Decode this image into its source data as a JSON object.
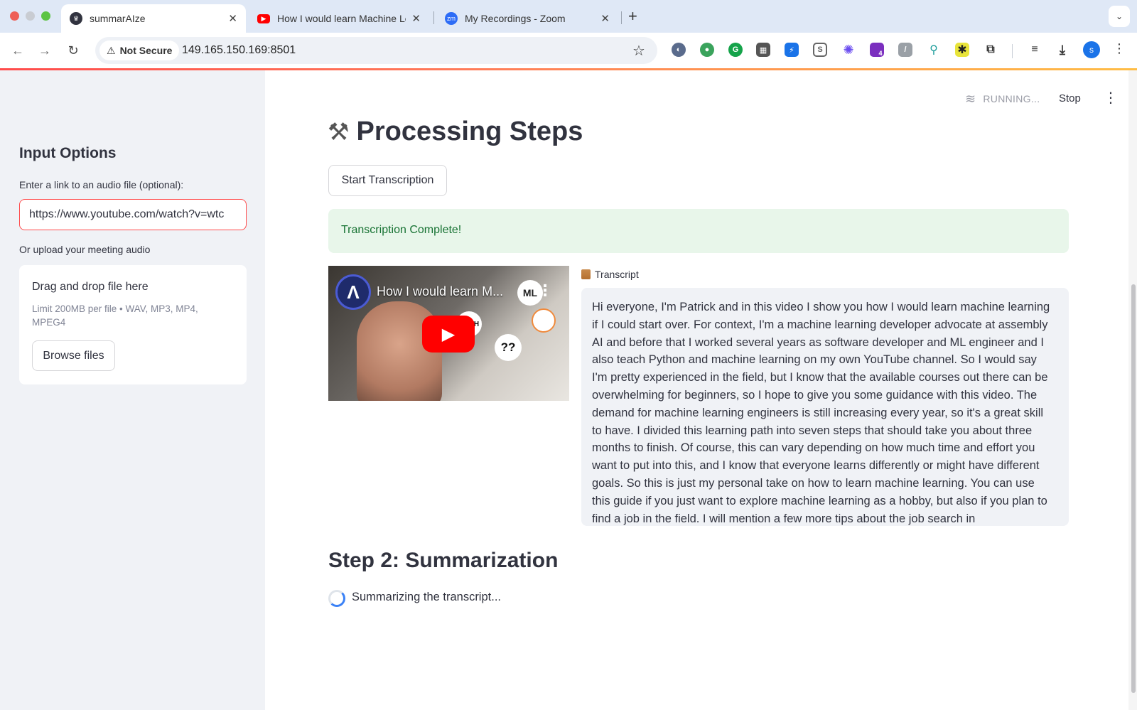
{
  "browser": {
    "tabs": [
      {
        "title": "summarAIze",
        "active": true
      },
      {
        "title": "How I would learn Machine Le",
        "active": false
      },
      {
        "title": "My Recordings - Zoom",
        "active": false
      }
    ],
    "new_tab": "+",
    "security_label": "Not Secure",
    "url": "149.165.150.169:8501",
    "profile_initial": "s",
    "extension_badge": "4"
  },
  "app": {
    "status": "RUNNING...",
    "stop_label": "Stop",
    "sidebar": {
      "title": "Input Options",
      "link_label": "Enter a link to an audio file (optional):",
      "link_value": "https://www.youtube.com/watch?v=wtc",
      "upload_label": "Or upload your meeting audio",
      "dropzone_title": "Drag and drop file here",
      "dropzone_limit": "Limit 200MB per file • WAV, MP3, MP4, MPEG4",
      "browse_label": "Browse files"
    },
    "main": {
      "title": "Processing Steps",
      "start_button": "Start Transcription",
      "success_message": "Transcription Complete!",
      "video": {
        "title": "How I would learn M...",
        "channel_initial": "Λ",
        "ml_badge": "ML",
        "qq_badge": "??",
        "math_badge": "MATH"
      },
      "transcript_label": "Transcript",
      "transcript_text": "Hi everyone, I'm Patrick and in this video I show you how I would learn machine learning if I could start over. For context, I'm a machine learning developer advocate at assembly AI and before that I worked several years as software developer and ML engineer and I also teach Python and machine learning on my own YouTube channel. So I would say I'm pretty experienced in the field, but I know that the available courses out there can be overwhelming for beginners, so I hope to give you some guidance with this video. The demand for machine learning engineers is still increasing every year, so it's a great skill to have. I divided this learning path into seven steps that should take you about three months to finish. Of course, this can vary depending on how much time and effort you want to put into this, and I know that everyone learns differently or might have different goals. So this is just my personal take on how to learn machine learning. You can use this guide if you just want to explore machine learning as a hobby, but also if you plan to find a job in the field. I will mention a few more tips about the job search in",
      "step2_title": "Step 2: Summarization",
      "step2_status": "Summarizing the transcript..."
    }
  },
  "colors": {
    "accent": "#ff4b4b",
    "success_bg": "#e8f6ea",
    "success_text": "#177233",
    "sidebar_bg": "#f0f2f6"
  }
}
